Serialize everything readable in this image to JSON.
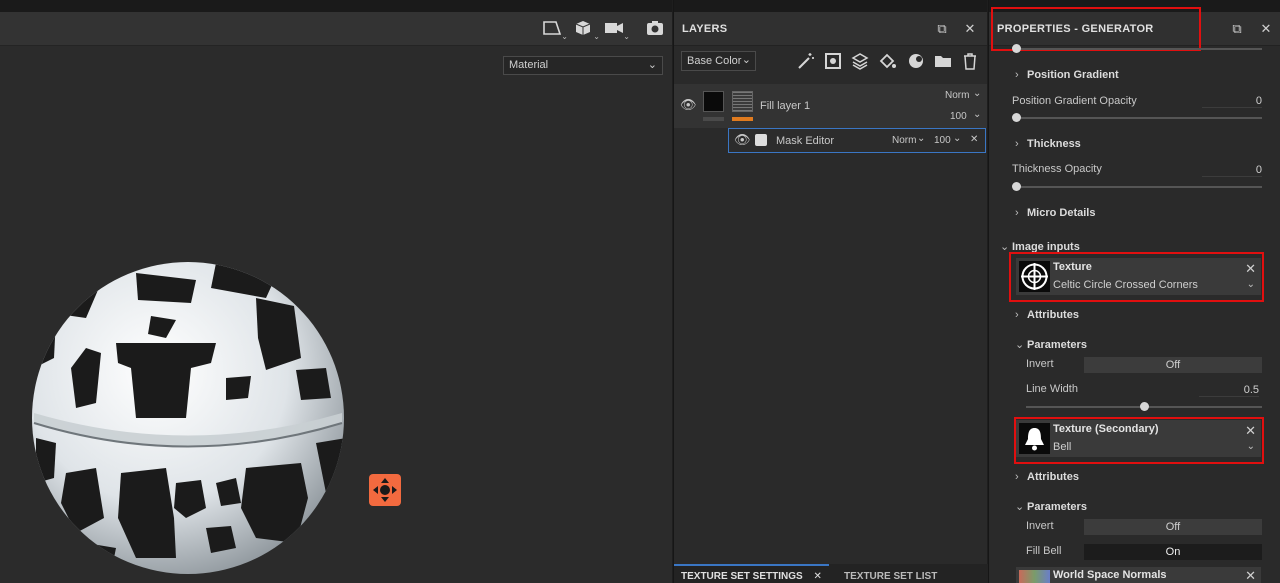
{
  "viewport": {
    "material_select": "Material",
    "toolbar_icons": [
      "frame-icon",
      "cube-icon",
      "camera-video-icon",
      "screenshot-camera-icon"
    ]
  },
  "layers": {
    "title": "LAYERS",
    "channel": "Base Color",
    "tools": [
      "magic-wand-icon",
      "add-mask-icon",
      "add-layer-icon",
      "add-fill-icon",
      "add-effect-icon",
      "add-folder-icon",
      "delete-icon"
    ],
    "fill_layer": {
      "name": "Fill layer 1",
      "blend": "Norm",
      "opacity": "100"
    },
    "mask": {
      "name": "Mask Editor",
      "blend": "Norm",
      "opacity": "100"
    },
    "bottom_tabs": [
      {
        "label": "TEXTURE SET SETTINGS",
        "active": true
      },
      {
        "label": "TEXTURE SET LIST",
        "active": false
      }
    ]
  },
  "props": {
    "title": "PROPERTIES - GENERATOR",
    "sections": {
      "position_gradient": "Position Gradient",
      "position_gradient_opacity_label": "Position Gradient Opacity",
      "position_gradient_opacity_value": "0",
      "thickness": "Thickness",
      "thickness_opacity_label": "Thickness Opacity",
      "thickness_opacity_value": "0",
      "micro_details": "Micro Details",
      "image_inputs": "Image inputs"
    },
    "texture1": {
      "label": "Texture",
      "value": "Celtic Circle Crossed Corners"
    },
    "attributes1": "Attributes",
    "parameters1": "Parameters",
    "invert1_label": "Invert",
    "invert1_value": "Off",
    "line_width_label": "Line Width",
    "line_width_value": "0.5",
    "line_width_level": 0.5,
    "texture2": {
      "label": "Texture (Secondary)",
      "value": "Bell"
    },
    "attributes2": "Attributes",
    "parameters2": "Parameters",
    "invert2_label": "Invert",
    "invert2_value": "Off",
    "fill_bell_label": "Fill Bell",
    "fill_bell_value": "On",
    "world_space_normals": "World Space Normals"
  },
  "colors": {
    "accent_blue": "#3a76c4",
    "highlight_red": "#e10f0f",
    "gizmo_orange": "#f26a3f",
    "layer_orange": "#e07b1f"
  }
}
